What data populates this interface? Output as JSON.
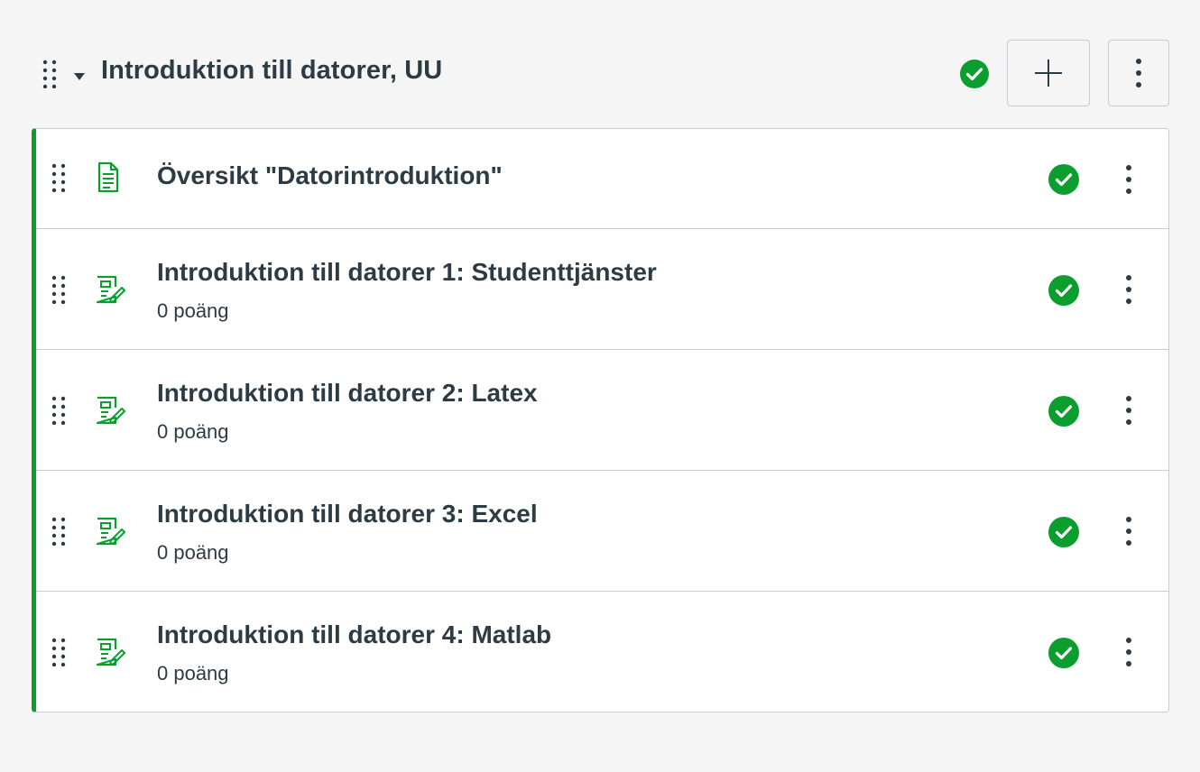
{
  "module": {
    "title": "Introduktion till datorer, UU",
    "published": true,
    "icons": {
      "drag": "drag-handle-icon",
      "collapse": "caret-down-icon",
      "status": "published-check-icon",
      "add": "plus-icon",
      "more": "kebab-menu-icon"
    }
  },
  "items": [
    {
      "title": "Översikt \"Datorintroduktion\"",
      "subtitle": "",
      "type": "page",
      "icon": "page-document-icon",
      "published": true
    },
    {
      "title": "Introduktion till datorer 1: Studenttjänster",
      "subtitle": "0 poäng",
      "type": "assignment",
      "icon": "assignment-icon",
      "published": true
    },
    {
      "title": "Introduktion till datorer 2: Latex",
      "subtitle": "0 poäng",
      "type": "assignment",
      "icon": "assignment-icon",
      "published": true
    },
    {
      "title": "Introduktion till datorer 3: Excel",
      "subtitle": "0 poäng",
      "type": "assignment",
      "icon": "assignment-icon",
      "published": true
    },
    {
      "title": "Introduktion till datorer 4: Matlab",
      "subtitle": "0 poäng",
      "type": "assignment",
      "icon": "assignment-icon",
      "published": true
    }
  ],
  "colors": {
    "published_green": "#0b9e2f",
    "text": "#2d3b45",
    "border": "#c7cdd1",
    "background": "#f5f5f5"
  }
}
